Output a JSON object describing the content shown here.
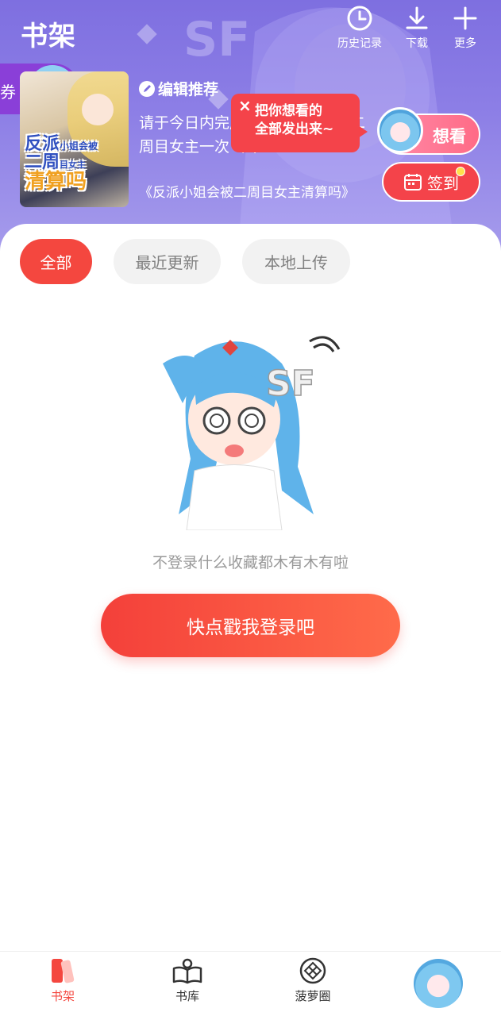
{
  "header": {
    "title": "书架",
    "actions": [
      {
        "label": "历史记录",
        "icon": "clock-icon"
      },
      {
        "label": "下载",
        "icon": "download-icon"
      },
      {
        "label": "更多",
        "icon": "plus-icon"
      }
    ]
  },
  "coupon_tab": {
    "label": "券"
  },
  "recommend": {
    "label": "编辑推荐",
    "text": "请于今日内完成阅读，并清算于二周目女主一次（0/",
    "book": "《反派小姐会被二周目女主清算吗》",
    "cover": {
      "line1": "反派",
      "line1_small": "小姐会被",
      "line2": "二周",
      "line2_small": "目女主",
      "line3": "清算吗"
    }
  },
  "bubble": {
    "close": "×",
    "line1": "把你想看的",
    "line2": "全部发出来~"
  },
  "want_button": {
    "label": "想看"
  },
  "sign_button": {
    "label": "签到"
  },
  "tabs": [
    {
      "label": "全部",
      "active": true
    },
    {
      "label": "最近更新",
      "active": false
    },
    {
      "label": "本地上传",
      "active": false
    }
  ],
  "empty_state": {
    "message": "不登录什么收藏都木有木有啦",
    "login_button": "快点戳我登录吧"
  },
  "bottom_nav": [
    {
      "label": "书架",
      "icon": "bookshelf-icon",
      "active": true
    },
    {
      "label": "书库",
      "icon": "open-book-icon",
      "active": false
    },
    {
      "label": "菠萝圈",
      "icon": "pineapple-circle-icon",
      "active": false
    }
  ],
  "colors": {
    "accent": "#f4473f",
    "header_purple": "#7e6fe0",
    "inactive_tab_bg": "#f2f2f2"
  }
}
